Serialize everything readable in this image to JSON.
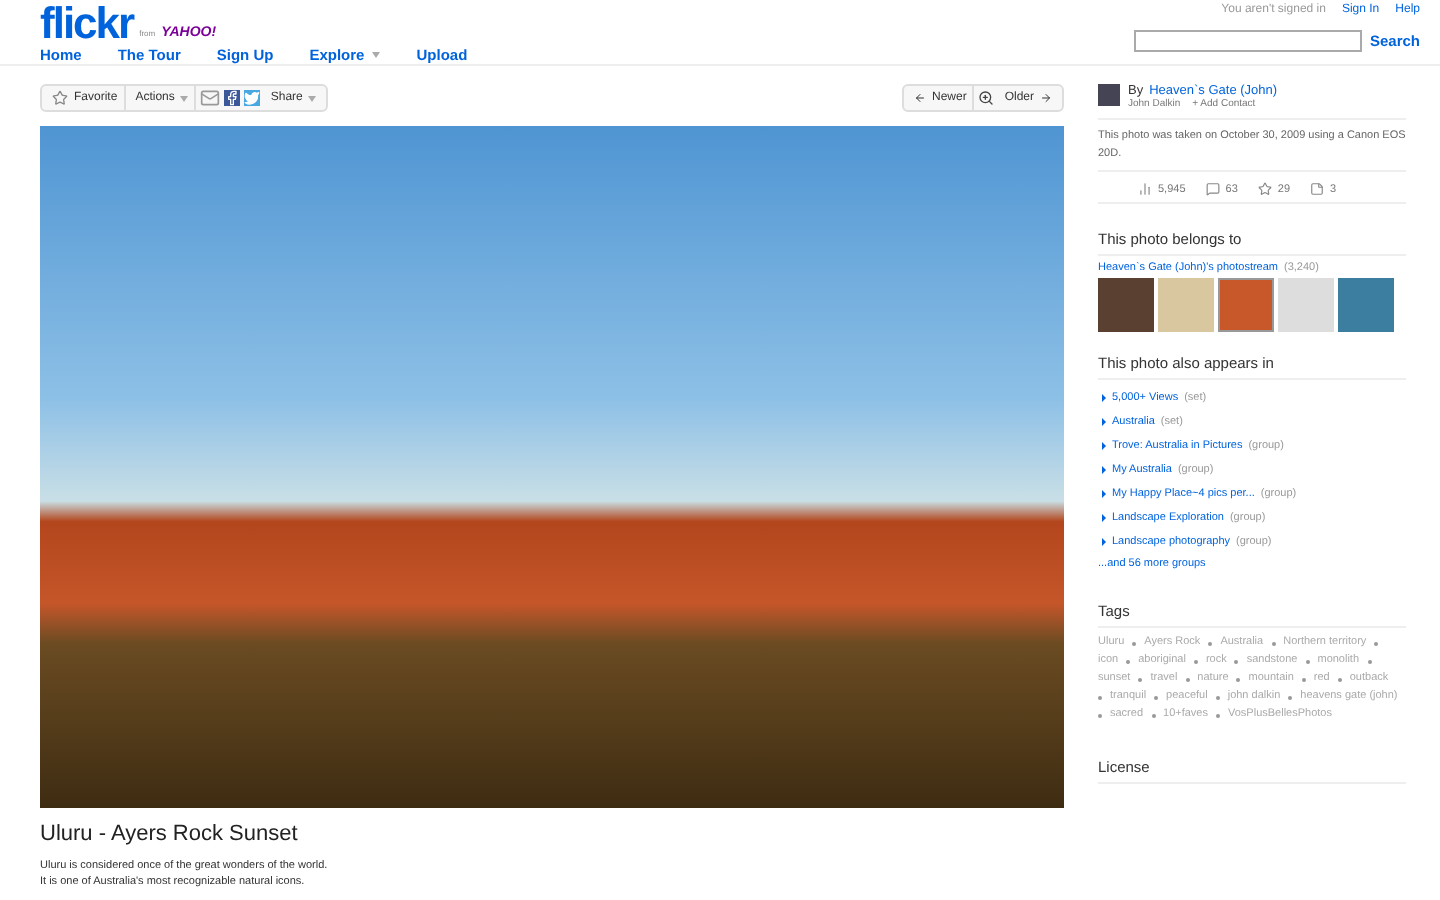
{
  "header": {
    "logo": "flickr",
    "logo_sub": "from",
    "logo_partner": "YAHOO!",
    "signed_out": "You aren't signed in",
    "links": [
      "Sign In",
      "Help"
    ],
    "nav": [
      {
        "label": "Home",
        "has_menu": false
      },
      {
        "label": "The Tour",
        "has_menu": false
      },
      {
        "label": "Sign Up",
        "has_menu": false
      },
      {
        "label": "Explore",
        "has_menu": true
      },
      {
        "label": "Upload",
        "has_menu": false
      }
    ],
    "search_button": "Search"
  },
  "toolbar": {
    "favorite": "Favorite",
    "actions": "Actions",
    "share": "Share",
    "newer": "Newer",
    "older": "Older"
  },
  "photo": {
    "title": "Uluru - Ayers Rock Sunset",
    "description": [
      "Uluru is considered once of the great wonders of the world.",
      "It is one of Australia's most recognizable natural icons."
    ]
  },
  "sidebar": {
    "by": "By",
    "owner": "Heaven`s Gate (John)",
    "real_name": "John Dalkin",
    "add_contact": "+ Add Contact",
    "taken": "This photo was taken on October 30, 2009 using a Canon EOS 20D.",
    "stats": [
      {
        "kind": "views",
        "value": "5,945"
      },
      {
        "kind": "comments",
        "value": "63"
      },
      {
        "kind": "faves",
        "value": "29"
      },
      {
        "kind": "notes",
        "value": "3"
      }
    ],
    "belongs_heading": "This photo belongs to",
    "photostream": "Heaven`s Gate (John)'s photostream",
    "photostream_count": "(3,240)",
    "thumbnails": [
      {
        "selected": false
      },
      {
        "selected": false
      },
      {
        "selected": true
      },
      {
        "selected": false
      },
      {
        "selected": false
      }
    ],
    "appears_heading": "This photo also appears in",
    "appears": [
      {
        "name": "5,000+ Views",
        "type": "(set)"
      },
      {
        "name": "Australia",
        "type": "(set)"
      },
      {
        "name": "Trove: Australia in Pictures",
        "type": "(group)"
      },
      {
        "name": "My Australia",
        "type": "(group)"
      },
      {
        "name": "My Happy Place~4 pics per...",
        "type": "(group)"
      },
      {
        "name": "Landscape Exploration",
        "type": "(group)"
      },
      {
        "name": "Landscape photography",
        "type": "(group)"
      }
    ],
    "more_groups": "...and 56 more groups",
    "tags_heading": "Tags",
    "tags": [
      "Uluru",
      "Ayers Rock",
      "Australia",
      "Northern territory",
      "icon",
      "aboriginal",
      "rock",
      "sandstone",
      "monolith",
      "sunset",
      "travel",
      "nature",
      "mountain",
      "red",
      "outback",
      "tranquil",
      "peaceful",
      "john dalkin",
      "heavens gate (john)",
      "sacred",
      "10+faves",
      "VosPlusBellesPhotos"
    ],
    "license_heading": "License"
  }
}
